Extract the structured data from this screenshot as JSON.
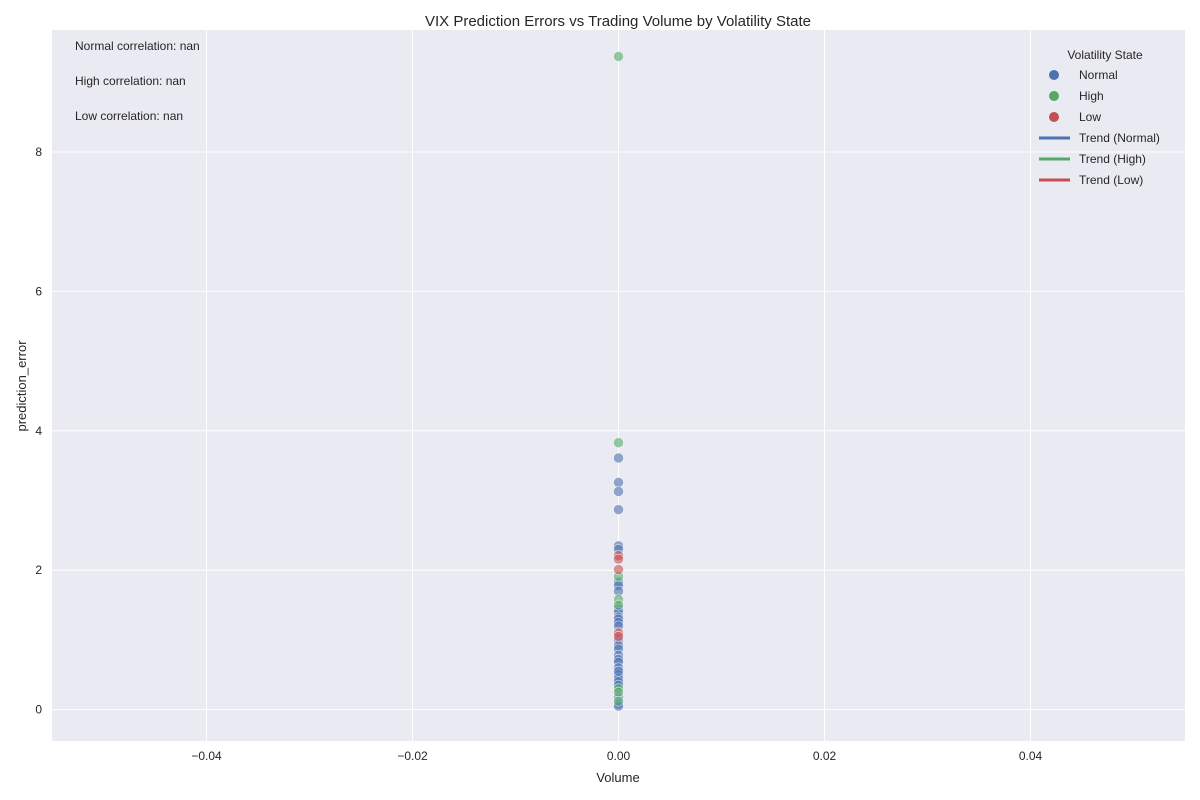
{
  "chart_data": {
    "type": "scatter",
    "title": "VIX Prediction Errors vs Trading Volume by Volatility State",
    "xlabel": "Volume",
    "ylabel": "prediction_error",
    "xlim": [
      -0.055,
      0.055
    ],
    "ylim": [
      -0.45,
      9.75
    ],
    "xticks": [
      -0.04,
      -0.02,
      0.0,
      0.02,
      0.04
    ],
    "xtick_labels": [
      "−0.04",
      "−0.02",
      "0.00",
      "0.02",
      "0.04"
    ],
    "yticks": [
      0,
      2,
      4,
      6,
      8
    ],
    "ytick_labels": [
      "0",
      "2",
      "4",
      "6",
      "8"
    ],
    "grid": true,
    "legend": {
      "title": "Volatility State",
      "placement": "top-right",
      "entries": [
        {
          "label": "Normal",
          "kind": "marker",
          "color": "#4c72b0"
        },
        {
          "label": "High",
          "kind": "marker",
          "color": "#55a868"
        },
        {
          "label": "Low",
          "kind": "marker",
          "color": "#c44e52"
        },
        {
          "label": "Trend (Normal)",
          "kind": "line",
          "color": "#4c72b0"
        },
        {
          "label": "Trend (High)",
          "kind": "line",
          "color": "#55a868"
        },
        {
          "label": "Trend (Low)",
          "kind": "line",
          "color": "#c44e52"
        }
      ]
    },
    "annotations": [
      "Normal correlation: nan",
      "High correlation: nan",
      "Low correlation: nan"
    ],
    "series": [
      {
        "name": "Normal",
        "color": "#4c72b0",
        "x": [
          0,
          0,
          0,
          0,
          0,
          0,
          0,
          0,
          0,
          0,
          0,
          0,
          0,
          0,
          0,
          0,
          0,
          0,
          0,
          0,
          0,
          0,
          0,
          0,
          0,
          0,
          0,
          0,
          0,
          0
        ],
        "y": [
          3.61,
          3.26,
          3.13,
          2.87,
          2.35,
          2.3,
          1.83,
          1.78,
          1.7,
          1.45,
          1.4,
          1.33,
          1.3,
          1.25,
          1.0,
          0.92,
          0.87,
          0.78,
          0.72,
          0.68,
          0.6,
          0.5,
          0.45,
          0.4,
          0.35,
          0.18,
          0.08,
          0.05,
          1.2,
          0.55
        ]
      },
      {
        "name": "High",
        "color": "#55a868",
        "x": [
          0,
          0,
          0,
          0,
          0,
          0,
          0,
          0
        ],
        "y": [
          9.37,
          3.83,
          1.91,
          1.58,
          1.5,
          0.3,
          0.25,
          0.12
        ]
      },
      {
        "name": "Low",
        "color": "#c44e52",
        "x": [
          0,
          0,
          0,
          0,
          0
        ],
        "y": [
          2.21,
          2.16,
          2.01,
          1.1,
          1.05
        ]
      }
    ]
  }
}
